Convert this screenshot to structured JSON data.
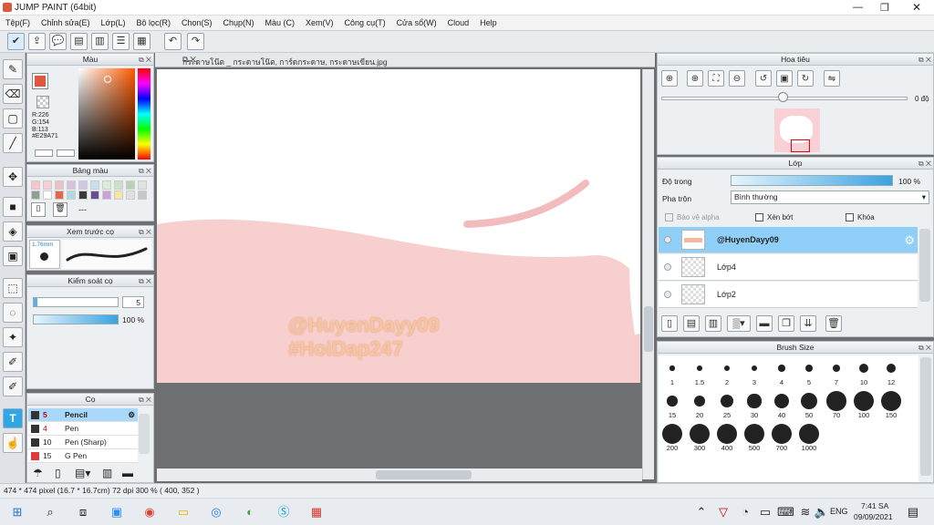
{
  "window": {
    "title": "JUMP PAINT (64bit)",
    "controls": [
      "—",
      "❐",
      "✕"
    ]
  },
  "menu": [
    "Tệp(F)",
    "Chỉnh sửa(E)",
    "Lớp(L)",
    "Bộ lọc(R)",
    "Chọn(S)",
    "Chụp(N)",
    "Màu (C)",
    "Xem(V)",
    "Công cụ(T)",
    "Cửa sổ(W)",
    "Cloud",
    "Help"
  ],
  "color_panel": {
    "title": "Màu",
    "r": "R:226",
    "g": "G:154",
    "b": "B:113",
    "hex": "#E29A71",
    "selected_color": "#E29A71"
  },
  "palette_panel": {
    "title": "Bảng màu",
    "swatches": [
      "#f9c5cc",
      "#f6d0d6",
      "#e8c2c8",
      "#d9c0e0",
      "#cfc7e8",
      "#c8dff0",
      "#d4f0d4",
      "#c9e3c6",
      "#b7d3b2",
      "#e2e2e2",
      "#8ca28f",
      "#ffffff",
      "#e8664a",
      "#b2d8e8",
      "#3a3a3a",
      "#6a4c8c",
      "#c8a2d8",
      "#f2e8a0",
      "#e0e0e0",
      "#c8c8c8"
    ],
    "extra": "---"
  },
  "preview_panel": {
    "title": "Xem trước cọ",
    "size": "1.76mm"
  },
  "brush_control": {
    "title": "Kiểm soát cọ",
    "size": "5",
    "opacity": "100 %"
  },
  "brush_panel": {
    "title": "Cọ",
    "items": [
      {
        "size": "5",
        "name": "Pencil",
        "color": "#333"
      },
      {
        "size": "4",
        "name": "Pen",
        "color": "#333"
      },
      {
        "size": "10",
        "name": "Pen (Sharp)",
        "color": "#333"
      },
      {
        "size": "15",
        "name": "G Pen",
        "color": "#e23a3a"
      }
    ]
  },
  "document": {
    "tab": "กระดาษโน๊ต _ กระดาษโน๊ต, การ์ดกระดาษ, กระดาษเขียน.jpg",
    "watermark1": "@HuyenDayy09",
    "watermark2": "#HoiDap247"
  },
  "navigator": {
    "title": "Hoa tiêu",
    "rotation": "0 độ"
  },
  "layer_panel": {
    "title": "Lớp",
    "opacity_label": "Độ trong",
    "opacity": "100 %",
    "blend_label": "Pha trộn",
    "blend": "Bình thường",
    "protect_alpha": "Bảo vệ alpha",
    "clip": "Xén bớt",
    "lock": "Khóa",
    "layers": [
      "@HuyenDayy09",
      "Lớp4",
      "Lớp2"
    ]
  },
  "brush_size": {
    "title": "Brush Size",
    "sizes": [
      "1",
      "1.5",
      "2",
      "3",
      "4",
      "5",
      "7",
      "10",
      "12",
      "15",
      "20",
      "25",
      "30",
      "40",
      "50",
      "70",
      "100",
      "150",
      "200",
      "300",
      "400",
      "500",
      "700",
      "1000"
    ]
  },
  "status": {
    "text": "474 * 474 pixel   (16.7 * 16.7cm)   72 dpi   300 %   ( 400, 352 )"
  },
  "taskbar": {
    "time": "7:41 SA",
    "date": "09/09/2021",
    "lang": "ENG"
  }
}
